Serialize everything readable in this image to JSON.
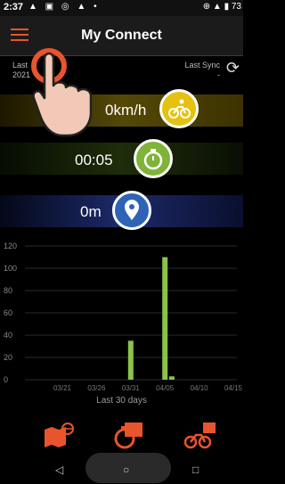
{
  "status": {
    "time": "2:37",
    "battery": "73"
  },
  "app": {
    "title": "My Connect"
  },
  "last": {
    "left_label": "Last",
    "left_value": "2021",
    "right_label": "Last Sync",
    "right_value": "-"
  },
  "stats": {
    "speed": "0km/h",
    "time": "00:05",
    "distance": "0m"
  },
  "chart_data": {
    "type": "bar",
    "x_labels": [
      "03/21",
      "03/26",
      "03/31",
      "04/05",
      "04/10",
      "04/15"
    ],
    "y_ticks": [
      "0",
      "20",
      "40",
      "60",
      "80",
      "100",
      "120"
    ],
    "ylim": [
      0,
      120
    ],
    "bars": [
      {
        "x": "03/31",
        "value": 35
      },
      {
        "x": "04/05",
        "value": 110
      },
      {
        "x": "04/06",
        "value": 3
      }
    ],
    "bar_color": "#8bc34a",
    "caption": "Last 30 days"
  }
}
